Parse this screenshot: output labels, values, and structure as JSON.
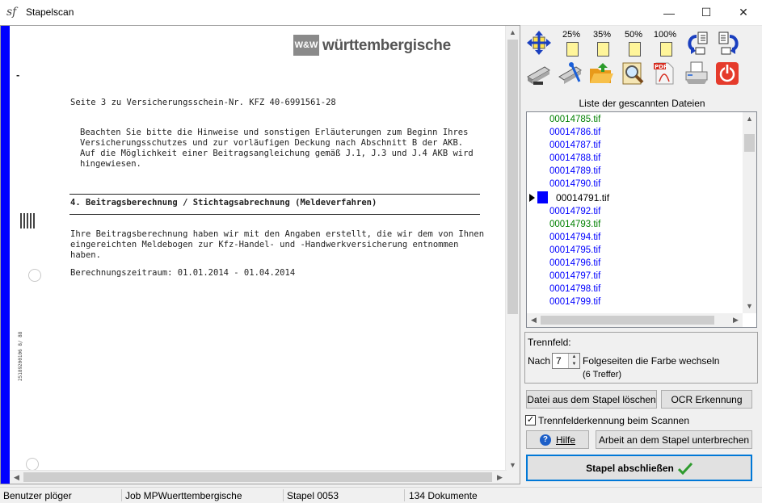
{
  "window": {
    "title": "Stapelscan",
    "app_icon": "sf-logo-icon",
    "controls": {
      "minimize": "—",
      "maximize": "☐",
      "close": "✕"
    }
  },
  "document": {
    "logo_badge": "W&W",
    "logo_text": "württembergische",
    "heading_line": "Seite 3 zu Versicherungsschein-Nr. KFZ 40-6991561-28",
    "paragraph1": "Beachten Sie bitte die Hinweise und sonstigen Erläuterungen zum Beginn Ihres\nVersicherungsschutzes und zur vorläufigen Deckung nach Abschnitt B der AKB.\nAuf die Möglichkeit einer Beitragsangleichung gemäß J.1, J.3 und J.4 AKB wird\nhingewiesen.",
    "section_title": "4. Beitragsberechnung / Stichtagsabrechnung (Meldeverfahren)",
    "paragraph2": "Ihre Beitragsberechnung haben wir mit den Angaben erstellt, die wir dem von Ihnen\neingereichten Meldebogen zur Kfz-Handel- und -Handwerkversicherung entnommen\nhaben.",
    "period_line": "Berechnungszeitraum: 01.01.2014 - 01.04.2014",
    "side_code": "25189200106  8/ 88",
    "margin_mark": "-"
  },
  "toolbar": {
    "zoom_labels": [
      "25%",
      "35%",
      "50%",
      "100%"
    ],
    "icons_row1": [
      "fit-page-icon",
      "zoom-25-icon",
      "zoom-35-icon",
      "zoom-50-icon",
      "zoom-100-icon",
      "rotate-left-icon",
      "rotate-right-icon"
    ],
    "icons_row2": [
      "scanner-icon",
      "scanner-settings-icon",
      "open-folder-icon",
      "search-document-icon",
      "pdf-icon",
      "print-icon",
      "power-icon"
    ]
  },
  "file_list": {
    "title": "Liste der gescannten Dateien",
    "items": [
      {
        "name": "00014785.tif",
        "color": "#008000"
      },
      {
        "name": "00014786.tif",
        "color": "#0000ff"
      },
      {
        "name": "00014787.tif",
        "color": "#0000ff"
      },
      {
        "name": "00014788.tif",
        "color": "#0000ff"
      },
      {
        "name": "00014789.tif",
        "color": "#0000ff"
      },
      {
        "name": "00014790.tif",
        "color": "#0000ff"
      },
      {
        "name": "00014791.tif",
        "color": "#000000"
      },
      {
        "name": "00014792.tif",
        "color": "#0000ff"
      },
      {
        "name": "00014793.tif",
        "color": "#008000"
      },
      {
        "name": "00014794.tif",
        "color": "#0000ff"
      },
      {
        "name": "00014795.tif",
        "color": "#0000ff"
      },
      {
        "name": "00014796.tif",
        "color": "#0000ff"
      },
      {
        "name": "00014797.tif",
        "color": "#0000ff"
      },
      {
        "name": "00014798.tif",
        "color": "#0000ff"
      },
      {
        "name": "00014799.tif",
        "color": "#0000ff"
      }
    ],
    "selected_index": 6
  },
  "separator": {
    "group_label": "Trennfeld:",
    "prefix": "Nach",
    "value": "7",
    "suffix": "Folgeseiten die Farbe wechseln",
    "hits": "(6 Treffer)"
  },
  "buttons": {
    "delete": "Datei aus dem Stapel löschen",
    "ocr": "OCR Erkennung",
    "help": "Hilfe",
    "pause": "Arbeit an dem Stapel unterbrechen",
    "finish": "Stapel abschließen"
  },
  "checkbox": {
    "label": "Trennfelderkennung beim Scannen",
    "checked": true
  },
  "statusbar": {
    "user": "Benutzer plöger",
    "job": "Job MPWuerttembergische",
    "batch": "Stapel 0053",
    "documents": "134 Dokumente"
  },
  "colors": {
    "accent_blue": "#0000ff",
    "finish_check": "#2e9b2e",
    "power_red": "#e53b2c"
  }
}
